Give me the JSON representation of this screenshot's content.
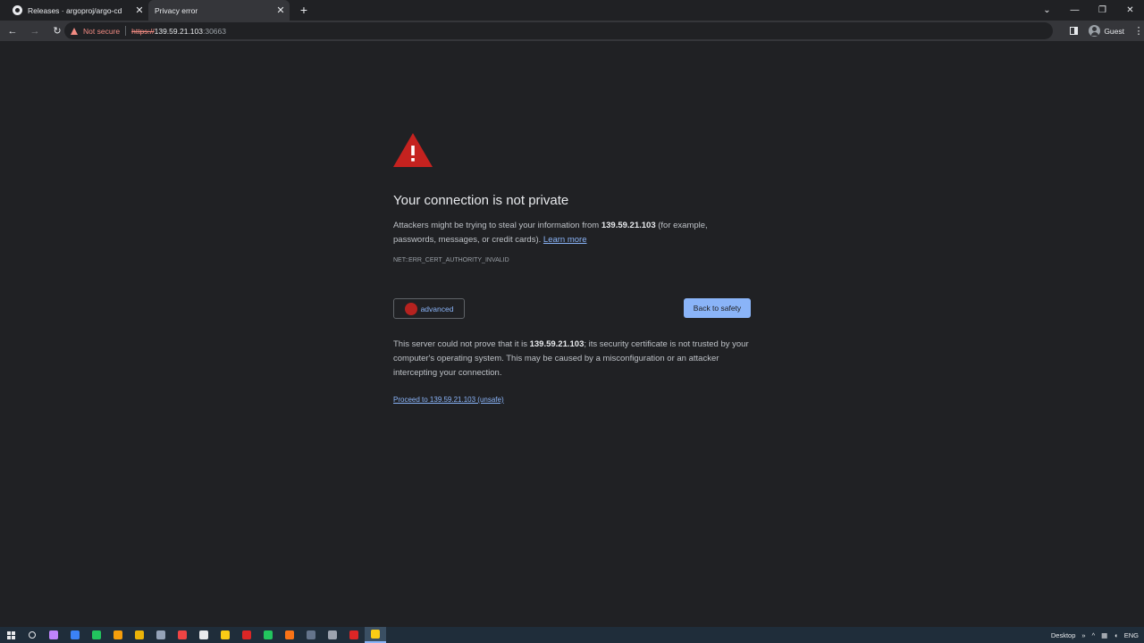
{
  "tabs": [
    {
      "title": "Releases · argoproj/argo-cd",
      "active": false,
      "icon": "github-icon"
    },
    {
      "title": "Privacy error",
      "active": true,
      "icon": "none"
    }
  ],
  "toolbar": {
    "security_label": "Not secure",
    "url_scheme": "https://",
    "url_host": "139.59.21.103",
    "url_port": ":30663",
    "profile_label": "Guest"
  },
  "interstitial": {
    "headline": "Your connection is not private",
    "msg_prefix": "Attackers might be trying to steal your information from ",
    "msg_host": "139.59.21.103",
    "msg_suffix": " (for example, passwords, messages, or credit cards). ",
    "learn_more": "Learn more",
    "error_code": "NET::ERR_CERT_AUTHORITY_INVALID",
    "advanced_label": "advanced",
    "back_label": "Back to safety",
    "details_prefix": "This server could not prove that it is ",
    "details_host": "139.59.21.103",
    "details_suffix": "; its security certificate is not trusted by your computer's operating system. This may be caused by a misconfiguration or an attacker intercepting your connection.",
    "proceed_label": "Proceed to 139.59.21.103 (unsafe)"
  },
  "taskbar": {
    "desktop_label": "Desktop",
    "lang_label": "ENG",
    "apps": [
      {
        "icon": "search-icon",
        "color": "#e8eaed"
      },
      {
        "icon": "app-icon-1",
        "color": "#c084fc"
      },
      {
        "icon": "app-icon-2",
        "color": "#3b82f6"
      },
      {
        "icon": "app-icon-3",
        "color": "#22c55e"
      },
      {
        "icon": "app-icon-4",
        "color": "#f59e0b"
      },
      {
        "icon": "app-icon-5",
        "color": "#eab308"
      },
      {
        "icon": "app-icon-6",
        "color": "#94a3b8"
      },
      {
        "icon": "app-icon-7",
        "color": "#ef4444"
      },
      {
        "icon": "app-icon-8",
        "color": "#e8eaed"
      },
      {
        "icon": "file-explorer-icon",
        "color": "#facc15"
      },
      {
        "icon": "app-icon-9",
        "color": "#dc2626"
      },
      {
        "icon": "chrome-icon",
        "color": "#22c55e"
      },
      {
        "icon": "vlc-icon",
        "color": "#f97316"
      },
      {
        "icon": "app-icon-10",
        "color": "#64748b"
      },
      {
        "icon": "app-icon-11",
        "color": "#9ca3af"
      },
      {
        "icon": "powerpoint-icon",
        "color": "#dc2626"
      },
      {
        "icon": "chrome-active-icon",
        "color": "#facc15"
      }
    ]
  },
  "colors": {
    "warning_red": "#c5221f",
    "link_blue": "#8ab4f8",
    "page_bg": "#202124"
  }
}
